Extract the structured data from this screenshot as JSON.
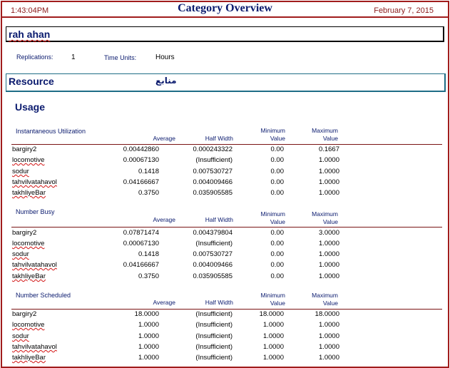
{
  "header": {
    "time": "1:43:04PM",
    "title": "Category Overview",
    "date": "February 7, 2015"
  },
  "model": {
    "name": "rah ahan"
  },
  "settings": {
    "replications_label": "Replications:",
    "replications_value": "1",
    "time_units_label": "Time Units:",
    "time_units_value": "Hours"
  },
  "category": {
    "label": "Resource",
    "arabic": "منابع"
  },
  "usage_title": "Usage",
  "columns": {
    "average": "Average",
    "half_width": "Half Width",
    "minimum": "Minimum",
    "minimum_2": "Value",
    "maximum": "Maximum",
    "maximum_2": "Value"
  },
  "sections": [
    {
      "title": "Instantaneous Utilization",
      "rows": [
        {
          "name": "bargiry2",
          "average": "0.00442860",
          "half_width": "0.000243322",
          "min": "0.00",
          "max": "0.1667"
        },
        {
          "name": "locomotive",
          "average": "0.00067130",
          "half_width": "(Insufficient)",
          "min": "0.00",
          "max": "1.0000"
        },
        {
          "name": "sodur",
          "average": "0.1418",
          "half_width": "0.007530727",
          "min": "0.00",
          "max": "1.0000"
        },
        {
          "name": "tahvilvatahavol",
          "average": "0.04166667",
          "half_width": "0.004009466",
          "min": "0.00",
          "max": "1.0000"
        },
        {
          "name": "takhliyeBar",
          "average": "0.3750",
          "half_width": "0.035905585",
          "min": "0.00",
          "max": "1.0000"
        }
      ]
    },
    {
      "title": "Number Busy",
      "rows": [
        {
          "name": "bargiry2",
          "average": "0.07871474",
          "half_width": "0.004379804",
          "min": "0.00",
          "max": "3.0000"
        },
        {
          "name": "locomotive",
          "average": "0.00067130",
          "half_width": "(Insufficient)",
          "min": "0.00",
          "max": "1.0000"
        },
        {
          "name": "sodur",
          "average": "0.1418",
          "half_width": "0.007530727",
          "min": "0.00",
          "max": "1.0000"
        },
        {
          "name": "tahvilvatahavol",
          "average": "0.04166667",
          "half_width": "0.004009466",
          "min": "0.00",
          "max": "1.0000"
        },
        {
          "name": "takhliyeBar",
          "average": "0.3750",
          "half_width": "0.035905585",
          "min": "0.00",
          "max": "1.0000"
        }
      ]
    },
    {
      "title": "Number Scheduled",
      "rows": [
        {
          "name": "bargiry2",
          "average": "18.0000",
          "half_width": "(Insufficient)",
          "min": "18.0000",
          "max": "18.0000"
        },
        {
          "name": "locomotive",
          "average": "1.0000",
          "half_width": "(Insufficient)",
          "min": "1.0000",
          "max": "1.0000"
        },
        {
          "name": "sodur",
          "average": "1.0000",
          "half_width": "(Insufficient)",
          "min": "1.0000",
          "max": "1.0000"
        },
        {
          "name": "tahvilvatahavol",
          "average": "1.0000",
          "half_width": "(Insufficient)",
          "min": "1.0000",
          "max": "1.0000"
        },
        {
          "name": "takhliyeBar",
          "average": "1.0000",
          "half_width": "(Insufficient)",
          "min": "1.0000",
          "max": "1.0000"
        }
      ]
    }
  ]
}
